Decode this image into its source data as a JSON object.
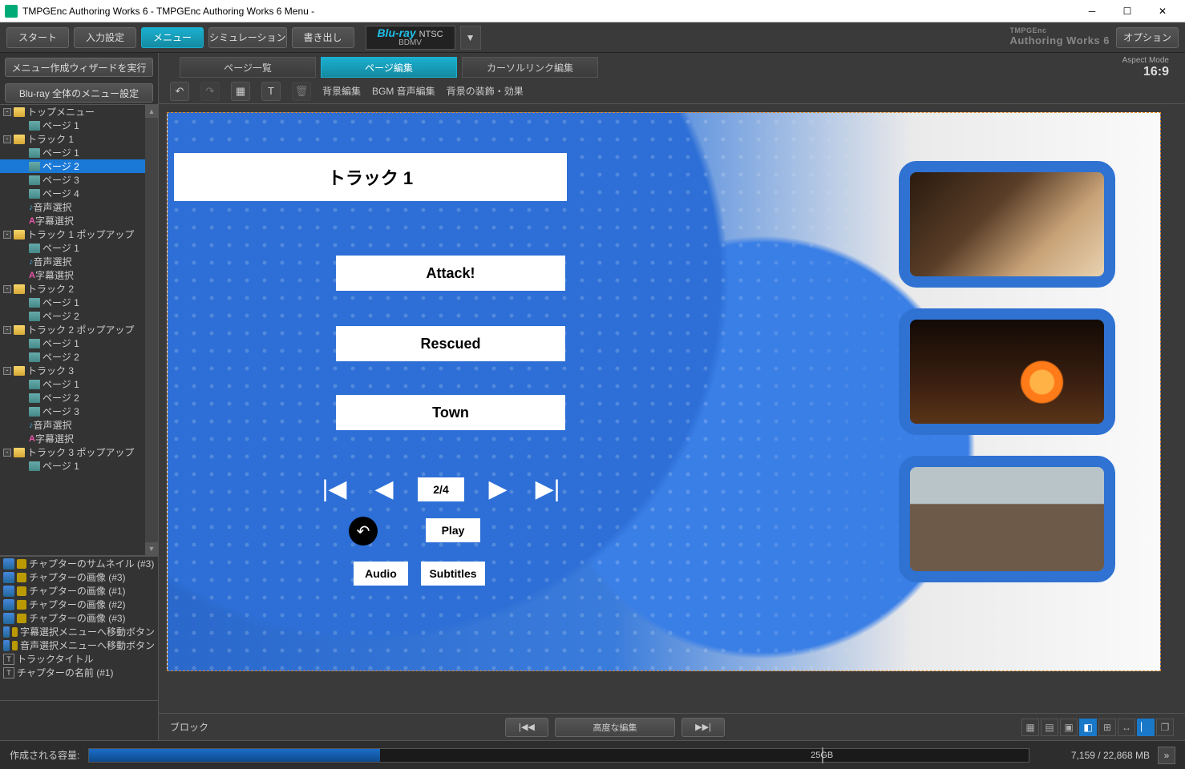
{
  "window": {
    "title": "TMPGEnc Authoring Works 6 - TMPGEnc Authoring Works 6 Menu -"
  },
  "toolbar": {
    "start": "スタート",
    "input": "入力設定",
    "menu": "メニュー",
    "sim": "シミュレーション",
    "write": "書き出し",
    "option": "オプション",
    "format_l1": "Blu-ray",
    "format_sub": "NTSC",
    "format_l2": "BDMV",
    "brand_small": "TMPGEnc",
    "brand": "Authoring Works 6"
  },
  "left": {
    "wizard": "メニュー作成ウィザードを実行",
    "global": "Blu-ray 全体のメニュー設定",
    "tree": [
      {
        "d": 0,
        "t": "sq",
        "open": "-"
      },
      {
        "d": 0,
        "t": "fold",
        "label": "トップメニュー"
      },
      {
        "d": 1,
        "t": "page",
        "label": "ページ 1"
      },
      {
        "d": 0,
        "t": "sq",
        "open": "-"
      },
      {
        "d": 0,
        "t": "fold",
        "label": "トラック 1"
      },
      {
        "d": 1,
        "t": "page",
        "label": "ページ 1"
      },
      {
        "d": 1,
        "t": "page",
        "label": "ページ 2",
        "sel": true
      },
      {
        "d": 1,
        "t": "page",
        "label": "ページ 3"
      },
      {
        "d": 1,
        "t": "page",
        "label": "ページ 4"
      },
      {
        "d": 1,
        "t": "aud",
        "label": "音声選択"
      },
      {
        "d": 1,
        "t": "sub",
        "label": "字幕選択"
      },
      {
        "d": 0,
        "t": "sq",
        "open": "-"
      },
      {
        "d": 0,
        "t": "fold",
        "label": "トラック 1 ポップアップ"
      },
      {
        "d": 1,
        "t": "page",
        "label": "ページ 1"
      },
      {
        "d": 1,
        "t": "aud",
        "label": "音声選択"
      },
      {
        "d": 1,
        "t": "sub",
        "label": "字幕選択"
      },
      {
        "d": 0,
        "t": "sq",
        "open": "-"
      },
      {
        "d": 0,
        "t": "fold",
        "label": "トラック 2"
      },
      {
        "d": 1,
        "t": "page",
        "label": "ページ 1"
      },
      {
        "d": 1,
        "t": "page",
        "label": "ページ 2"
      },
      {
        "d": 0,
        "t": "sq",
        "open": "-"
      },
      {
        "d": 0,
        "t": "fold",
        "label": "トラック 2 ポップアップ"
      },
      {
        "d": 1,
        "t": "page",
        "label": "ページ 1"
      },
      {
        "d": 1,
        "t": "page",
        "label": "ページ 2"
      },
      {
        "d": 0,
        "t": "sq",
        "open": "-"
      },
      {
        "d": 0,
        "t": "fold",
        "label": "トラック 3"
      },
      {
        "d": 1,
        "t": "page",
        "label": "ページ 1"
      },
      {
        "d": 1,
        "t": "page",
        "label": "ページ 2"
      },
      {
        "d": 1,
        "t": "page",
        "label": "ページ 3"
      },
      {
        "d": 1,
        "t": "aud",
        "label": "音声選択"
      },
      {
        "d": 1,
        "t": "sub",
        "label": "字幕選択"
      },
      {
        "d": 0,
        "t": "sq",
        "open": "-"
      },
      {
        "d": 0,
        "t": "fold",
        "label": "トラック 3 ポップアップ"
      },
      {
        "d": 1,
        "t": "page",
        "label": "ページ 1"
      }
    ],
    "props": [
      {
        "ic": "a",
        "lk": true,
        "label": "チャプターのサムネイル (#3)"
      },
      {
        "ic": "a",
        "lk": true,
        "label": "チャプターの画像 (#3)"
      },
      {
        "ic": "a",
        "lk": true,
        "label": "チャプターの画像 (#1)"
      },
      {
        "ic": "a",
        "lk": true,
        "label": "チャプターの画像 (#2)"
      },
      {
        "ic": "a",
        "lk": true,
        "label": "チャプターの画像 (#3)"
      },
      {
        "ic": "a",
        "lk": true,
        "label": "字幕選択メニューへ移動ボタン"
      },
      {
        "ic": "a",
        "lk": true,
        "label": "音声選択メニューへ移動ボタン"
      },
      {
        "ic": "t",
        "lk": false,
        "label": "トラックタイトル"
      },
      {
        "ic": "t",
        "lk": false,
        "label": "チャプターの名前 (#1)"
      }
    ]
  },
  "tabs": {
    "list": "ページ一覧",
    "edit": "ページ編集",
    "cursor": "カーソルリンク編集"
  },
  "aspect": {
    "label": "Aspect Mode",
    "value": "16:9"
  },
  "toolrow": {
    "bg": "背景編集",
    "bgm": "BGM 音声編集",
    "deco": "背景の装飾・効果"
  },
  "menu": {
    "title": "トラック 1",
    "chapters": [
      "Attack!",
      "Rescued",
      "Town"
    ],
    "page": "2/4",
    "play": "Play",
    "audio": "Audio",
    "subtitles": "Subtitles"
  },
  "bottom": {
    "block": "ブロック",
    "adv": "高度な編集"
  },
  "capacity": {
    "label": "作成される容量:",
    "mark": "25GB",
    "text": "7,159 / 22,868 MB",
    "fill_pct": 31,
    "mark_pct": 78
  }
}
